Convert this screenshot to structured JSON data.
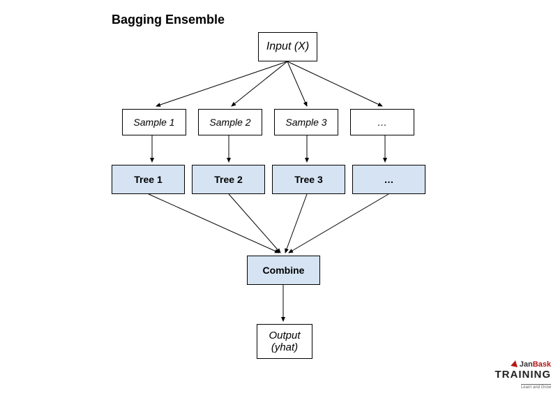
{
  "title": "Bagging Ensemble",
  "nodes": {
    "input": "Input (X)",
    "samples": [
      "Sample 1",
      "Sample 2",
      "Sample 3",
      "…"
    ],
    "trees": [
      "Tree 1",
      "Tree 2",
      "Tree 3",
      "…"
    ],
    "combine": "Combine",
    "output_l1": "Output",
    "output_l2": "(yhat)"
  },
  "logo": {
    "brand_part1": "Jan",
    "brand_part2": "Bask",
    "line2": "TRAINING",
    "tagline": "Learn and Grow"
  }
}
